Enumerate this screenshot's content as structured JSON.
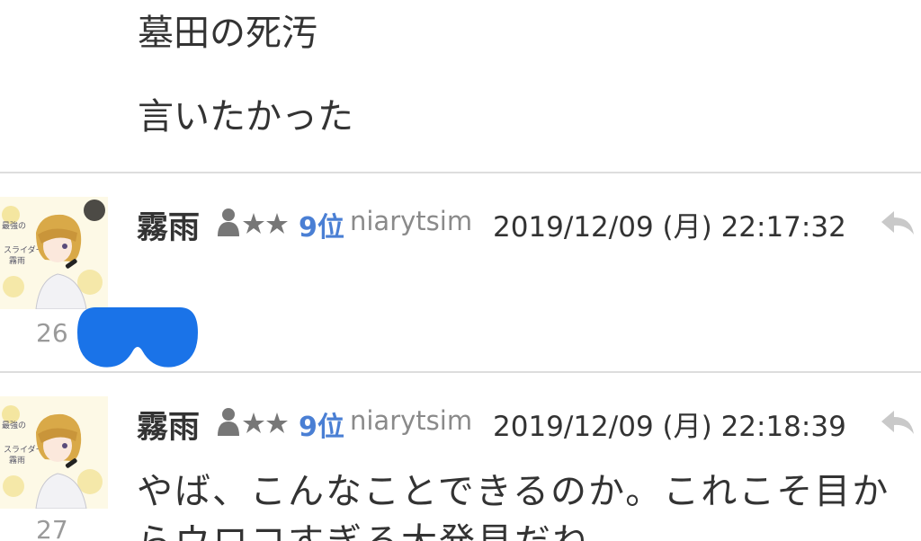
{
  "previous_post": {
    "lines": [
      "墓田の死汚",
      "言いたかった"
    ]
  },
  "posts": [
    {
      "username": "霧雨",
      "rank": "9位",
      "user_id": "niarytsim",
      "timestamp": "2019/12/09 (月) 22:17:32",
      "number": "26",
      "body_lines": [],
      "reaction_color": "#1a73e8"
    },
    {
      "username": "霧雨",
      "rank": "9位",
      "user_id": "niarytsim",
      "timestamp": "2019/12/09 (月) 22:18:39",
      "number": "27",
      "body_lines": [
        "やば、こんなことできるのか。これこそ目か",
        "らウロコすぎる大発見だね"
      ]
    }
  ],
  "icons": {
    "rank": "user-stars-icon",
    "reply": "reply-arrow-icon",
    "avatar": "anime-avatar"
  },
  "colors": {
    "rank": "#4a7fd4",
    "user_id": "#8a8a8a",
    "divider": "#dddddd"
  }
}
